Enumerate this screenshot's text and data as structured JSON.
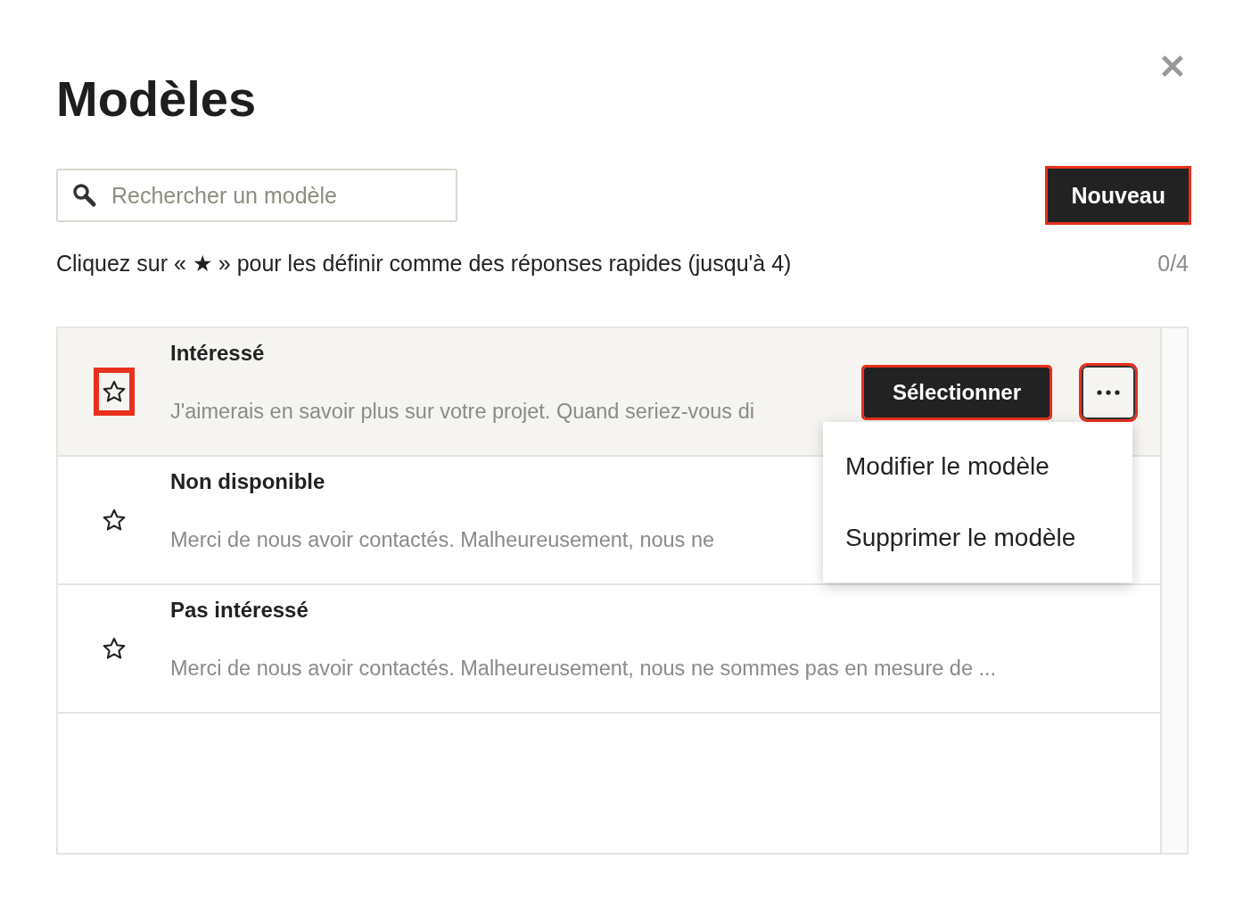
{
  "title": "Modèles",
  "close": {
    "label": "✕"
  },
  "search": {
    "placeholder": "Rechercher un modèle"
  },
  "new_button": {
    "label": "Nouveau",
    "highlighted": true
  },
  "hint": "Cliquez sur « ★ » pour les définir comme des réponses rapides (jusqu'à 4)",
  "counter": "0/4",
  "templates": [
    {
      "title": "Intéressé",
      "preview": "J'aimerais en savoir plus sur votre projet. Quand seriez-vous di",
      "starred": false,
      "star_highlighted": true,
      "hovered": true,
      "actions": {
        "select_label": "Sélectionner",
        "select_highlighted": true,
        "more_highlighted": true
      },
      "menu": {
        "items": [
          {
            "label": "Modifier le modèle"
          },
          {
            "label": "Supprimer le modèle"
          }
        ]
      }
    },
    {
      "title": "Non disponible",
      "preview": "Merci de nous avoir contactés. Malheureusement, nous ne",
      "starred": false,
      "star_highlighted": false,
      "hovered": false
    },
    {
      "title": "Pas intéressé",
      "preview": "Merci de nous avoir contactés. Malheureusement, nous ne sommes pas en mesure de ...",
      "starred": false,
      "star_highlighted": false,
      "hovered": false
    }
  ]
}
